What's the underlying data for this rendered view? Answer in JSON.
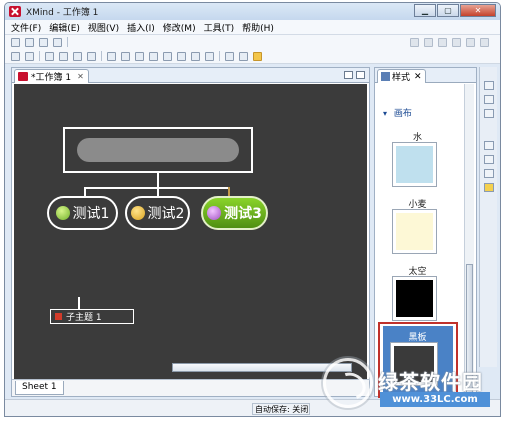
{
  "window": {
    "title": "XMind - 工作簿 1"
  },
  "menu": [
    "文件(F)",
    "编辑(E)",
    "视图(V)",
    "插入(I)",
    "修改(M)",
    "工具(T)",
    "帮助(H)"
  ],
  "editor": {
    "tab_label": "*工作簿 1",
    "tab_close": "✕",
    "sheet_tab": "Sheet 1"
  },
  "mindmap": {
    "topics": [
      {
        "label": "测试1",
        "icon": "smile-face-icon"
      },
      {
        "label": "测试2",
        "icon": "neutral-face-icon"
      },
      {
        "label": "测试3",
        "icon": "surprised-face-icon"
      }
    ],
    "subtopic": "子主题 1",
    "central_topic": "blurred"
  },
  "style_panel": {
    "tab_label": "样式",
    "tab_close": "✕",
    "section": "画布",
    "styles": [
      {
        "label": "水",
        "color": "#bfe0ee"
      },
      {
        "label": "小麦",
        "color": "#fdf8d6"
      },
      {
        "label": "太空",
        "color": "#000000"
      },
      {
        "label": "黑板",
        "color": "#3a3a3a",
        "selected": true
      }
    ]
  },
  "status": {
    "autosave": "自动保存: 关闭"
  },
  "watermark": {
    "text": "绿茶软件园",
    "url": "www.33LC.com"
  },
  "colors": {
    "canvas": "#3b3b3b",
    "accent": "#4a82c6",
    "highlight": "#c0312b",
    "topic3": "#6cb81f"
  }
}
